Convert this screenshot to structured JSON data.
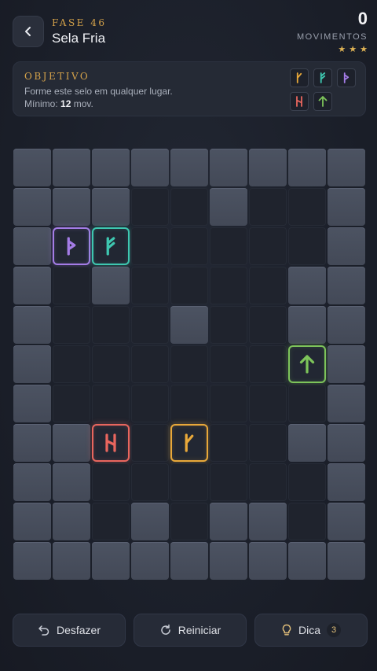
{
  "header": {
    "level_label": "FASE 46",
    "level_name": "Sela Fria",
    "moves_count": "0",
    "moves_label": "MOVIMENTOS",
    "stars": 3
  },
  "objective": {
    "title": "OBJETIVO",
    "description": "Forme este selo em qualquer lugar.",
    "minimum_label": "Mínimo:",
    "minimum_value": "12",
    "minimum_unit": "mov."
  },
  "colors": {
    "gold": "#e8a83a",
    "teal": "#3ec7b0",
    "purple": "#a47ce6",
    "red": "#e8665e",
    "green": "#7dc45a"
  },
  "runes": {
    "gold": {
      "icon": "kaun-rune-icon",
      "color": "#e8a83a"
    },
    "teal": {
      "icon": "fehu-rune-icon",
      "color": "#3ec7b0"
    },
    "purple": {
      "icon": "thurisaz-rune-icon",
      "color": "#a47ce6"
    },
    "red": {
      "icon": "hagalaz-rune-icon",
      "color": "#e8665e"
    },
    "green": {
      "icon": "arrow-up-rune-icon",
      "color": "#7dc45a"
    }
  },
  "pattern": [
    [
      "gold",
      "teal",
      "purple"
    ],
    [
      "red",
      "green",
      null
    ]
  ],
  "board": {
    "rows": [
      "#########",
      "###..#..#",
      "#PT.....#",
      "#.#....##",
      "#...#..##",
      "#......G#",
      "#.......#",
      "##R.Y..##",
      "##......#",
      "##.#.##.#",
      "#########"
    ],
    "legend": {
      "P": "purple",
      "T": "teal",
      "G": "green",
      "R": "red",
      "Y": "gold"
    }
  },
  "footer": {
    "undo_label": "Desfazer",
    "restart_label": "Reiniciar",
    "hint_label": "Dica",
    "hint_count": "3"
  }
}
